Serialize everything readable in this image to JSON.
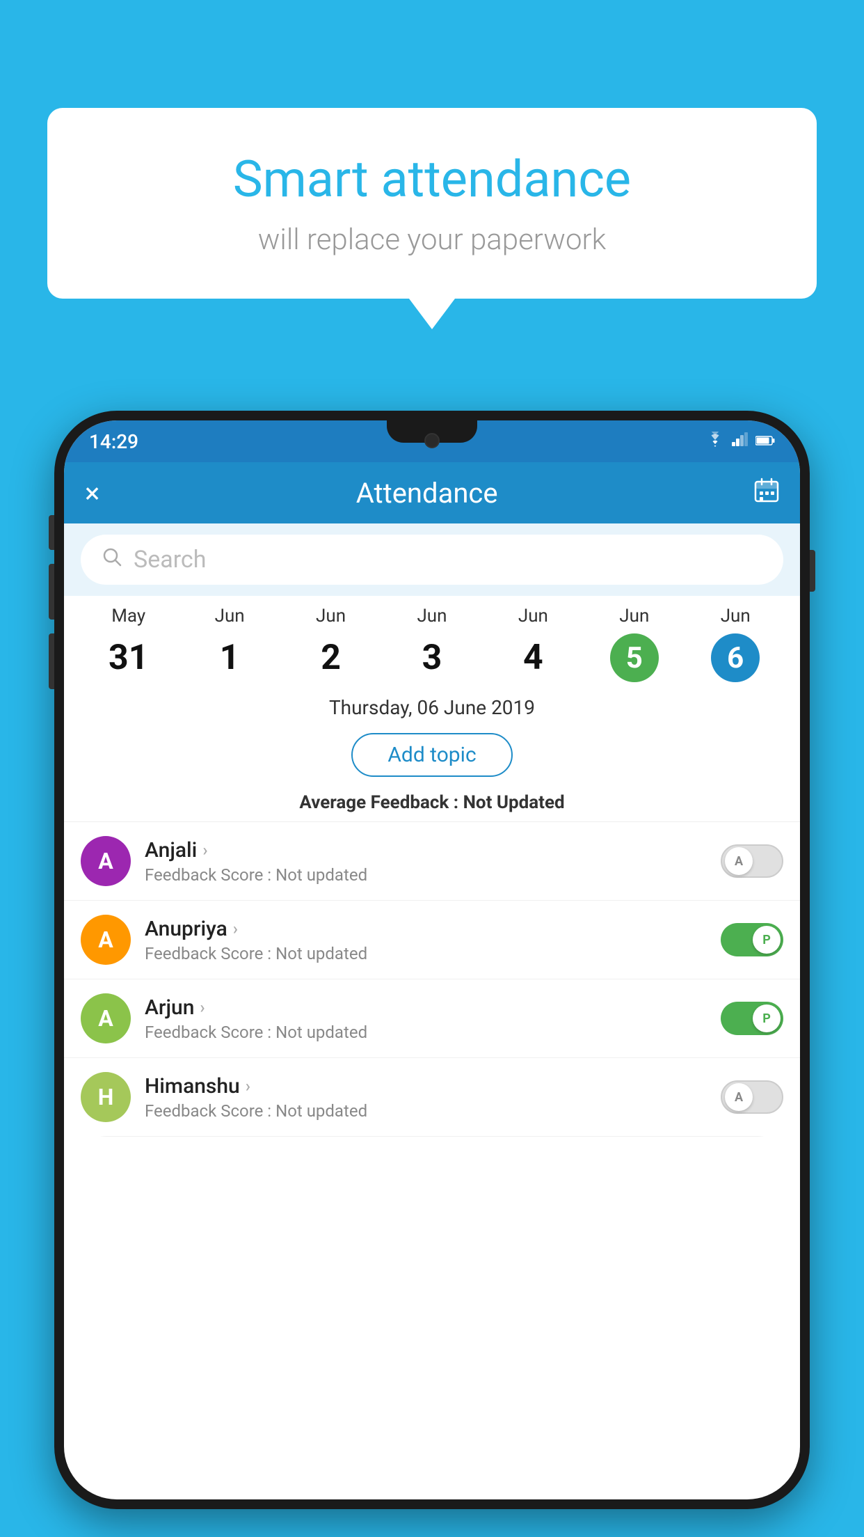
{
  "background_color": "#29b6e8",
  "speech_bubble": {
    "title": "Smart attendance",
    "subtitle": "will replace your paperwork"
  },
  "status_bar": {
    "time": "14:29",
    "wifi_icon": "wifi",
    "signal_icon": "signal",
    "battery_icon": "battery"
  },
  "header": {
    "title": "Attendance",
    "close_icon": "×",
    "calendar_icon": "📅"
  },
  "search": {
    "placeholder": "Search"
  },
  "calendar": {
    "days": [
      {
        "month": "May",
        "num": "31",
        "style": "normal"
      },
      {
        "month": "Jun",
        "num": "1",
        "style": "normal"
      },
      {
        "month": "Jun",
        "num": "2",
        "style": "normal"
      },
      {
        "month": "Jun",
        "num": "3",
        "style": "normal"
      },
      {
        "month": "Jun",
        "num": "4",
        "style": "normal"
      },
      {
        "month": "Jun",
        "num": "5",
        "style": "green"
      },
      {
        "month": "Jun",
        "num": "6",
        "style": "blue"
      }
    ]
  },
  "selected_date": "Thursday, 06 June 2019",
  "add_topic_label": "Add topic",
  "average_feedback": {
    "label": "Average Feedback : ",
    "value": "Not Updated"
  },
  "students": [
    {
      "name": "Anjali",
      "avatar_letter": "A",
      "avatar_color": "#9c27b0",
      "feedback_label": "Feedback Score : ",
      "feedback_value": "Not updated",
      "toggle": "off",
      "toggle_letter": "A"
    },
    {
      "name": "Anupriya",
      "avatar_letter": "A",
      "avatar_color": "#ff9800",
      "feedback_label": "Feedback Score : ",
      "feedback_value": "Not updated",
      "toggle": "on",
      "toggle_letter": "P"
    },
    {
      "name": "Arjun",
      "avatar_letter": "A",
      "avatar_color": "#8bc34a",
      "feedback_label": "Feedback Score : ",
      "feedback_value": "Not updated",
      "toggle": "on",
      "toggle_letter": "P"
    },
    {
      "name": "Himanshu",
      "avatar_letter": "H",
      "avatar_color": "#a5c85a",
      "feedback_label": "Feedback Score : ",
      "feedback_value": "Not updated",
      "toggle": "off",
      "toggle_letter": "A"
    }
  ]
}
